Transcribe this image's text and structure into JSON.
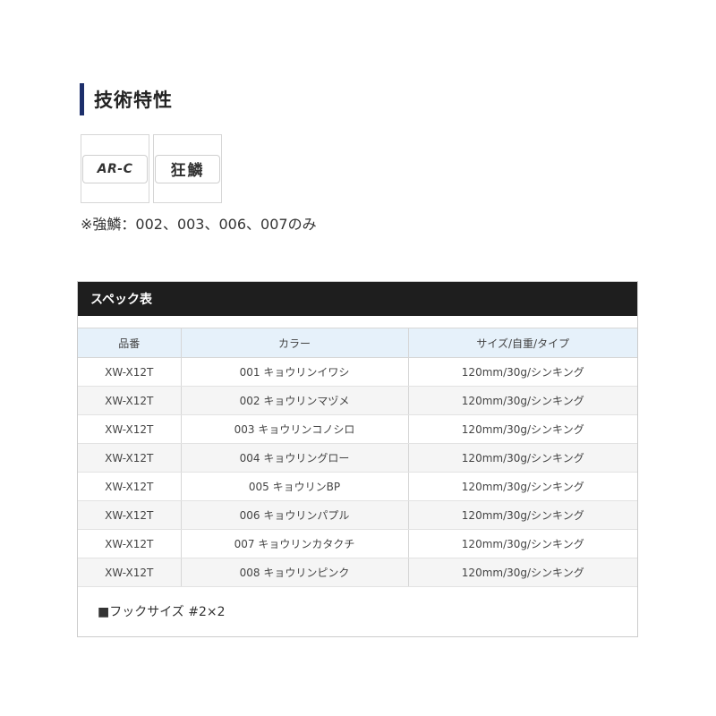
{
  "section": {
    "title": "技術特性"
  },
  "badges": [
    {
      "label": "AR-C"
    },
    {
      "label": "狂鱗"
    }
  ],
  "tech_note": "※強鱗：002、003、006、007のみ",
  "spec": {
    "title": "スペック表",
    "headers": {
      "part": "品番",
      "color": "カラー",
      "size": "サイズ/自重/タイプ"
    },
    "rows": [
      {
        "part": "XW-X12T",
        "color": "001 キョウリンイワシ",
        "size": "120mm/30g/シンキング"
      },
      {
        "part": "XW-X12T",
        "color": "002 キョウリンマヅメ",
        "size": "120mm/30g/シンキング"
      },
      {
        "part": "XW-X12T",
        "color": "003 キョウリンコノシロ",
        "size": "120mm/30g/シンキング"
      },
      {
        "part": "XW-X12T",
        "color": "004 キョウリングロー",
        "size": "120mm/30g/シンキング"
      },
      {
        "part": "XW-X12T",
        "color": "005 キョウリンBP",
        "size": "120mm/30g/シンキング"
      },
      {
        "part": "XW-X12T",
        "color": "006 キョウリンパプル",
        "size": "120mm/30g/シンキング"
      },
      {
        "part": "XW-X12T",
        "color": "007 キョウリンカタクチ",
        "size": "120mm/30g/シンキング"
      },
      {
        "part": "XW-X12T",
        "color": "008 キョウリンピンク",
        "size": "120mm/30g/シンキング"
      }
    ],
    "hook_note": "■フックサイズ #2×2"
  }
}
